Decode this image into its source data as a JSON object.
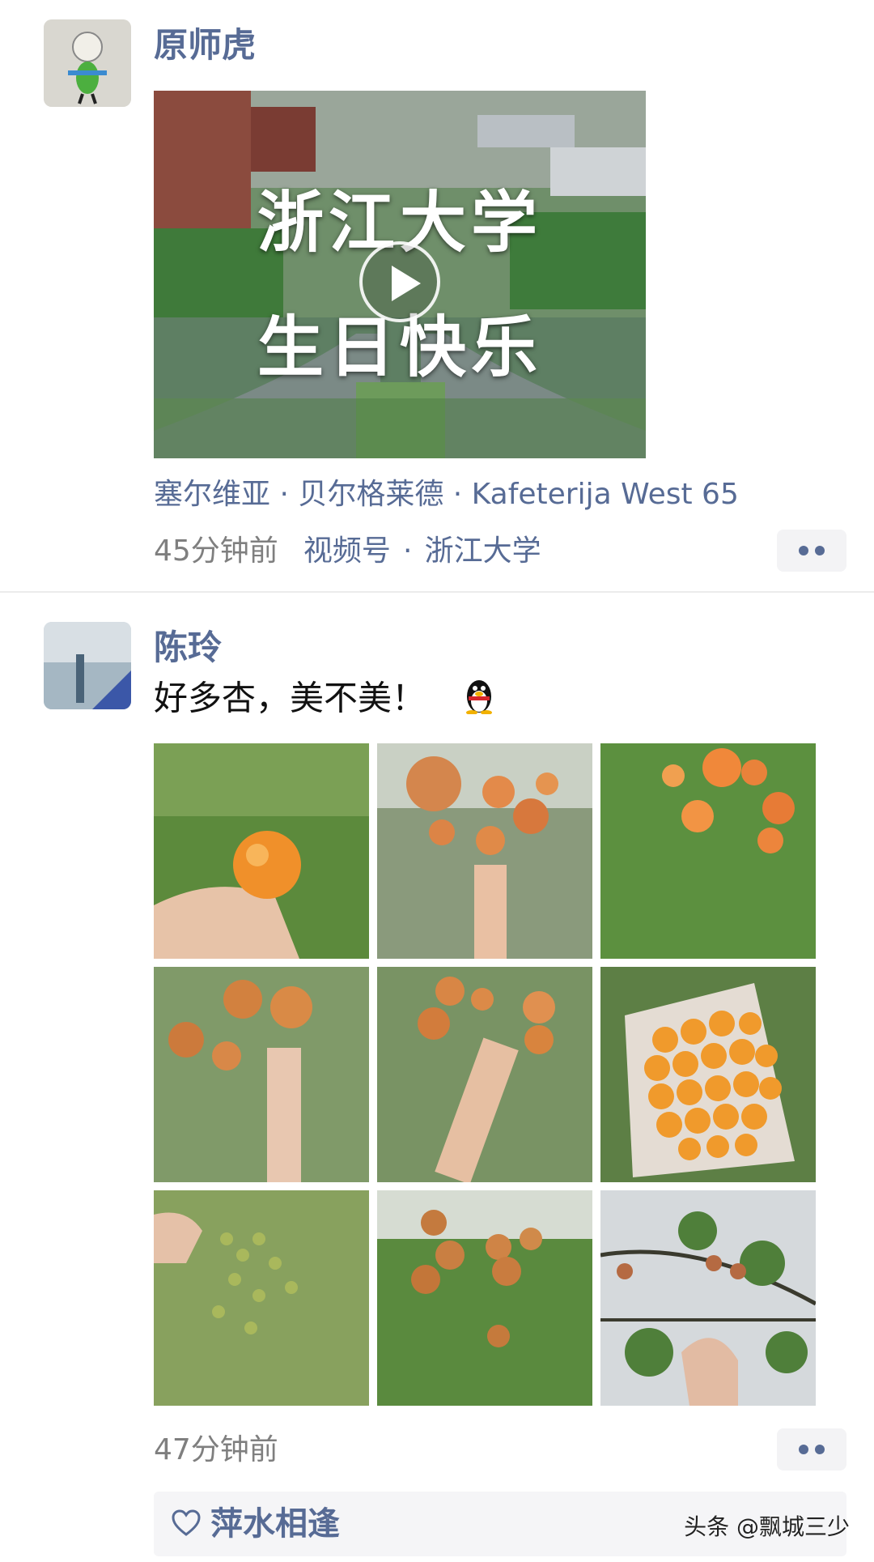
{
  "post1": {
    "author": "原师虎",
    "video": {
      "title_line1": "浙江大学",
      "title_line2": "生日快乐"
    },
    "location": "塞尔维亚 · 贝尔格莱德 · Kafeterija West 65",
    "time": "45分钟前",
    "source_label": "视频号",
    "source_sep": "·",
    "source_name": "浙江大学"
  },
  "post2": {
    "author": "陈玲",
    "text": "好多杏，美不美！",
    "time": "47分钟前",
    "liked_by": "萍水相逢"
  },
  "watermark": "头条 @飘城三少",
  "icons": {
    "play": "play-icon",
    "more": "more-dots-icon",
    "heart": "heart-icon",
    "emoji": "qq-penguin-emoji-icon"
  },
  "colors": {
    "link_blue": "#576b95",
    "meta_gray": "#7f7f7f"
  }
}
